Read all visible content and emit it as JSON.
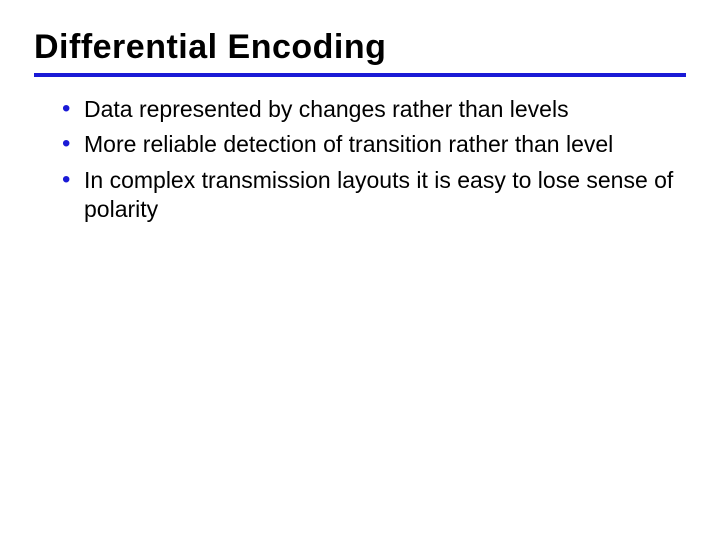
{
  "slide": {
    "title": "Differential Encoding",
    "bullets": [
      "Data represented by changes rather than levels",
      "More reliable detection of transition rather than level",
      "In complex transmission layouts it is easy to lose sense of polarity"
    ]
  }
}
